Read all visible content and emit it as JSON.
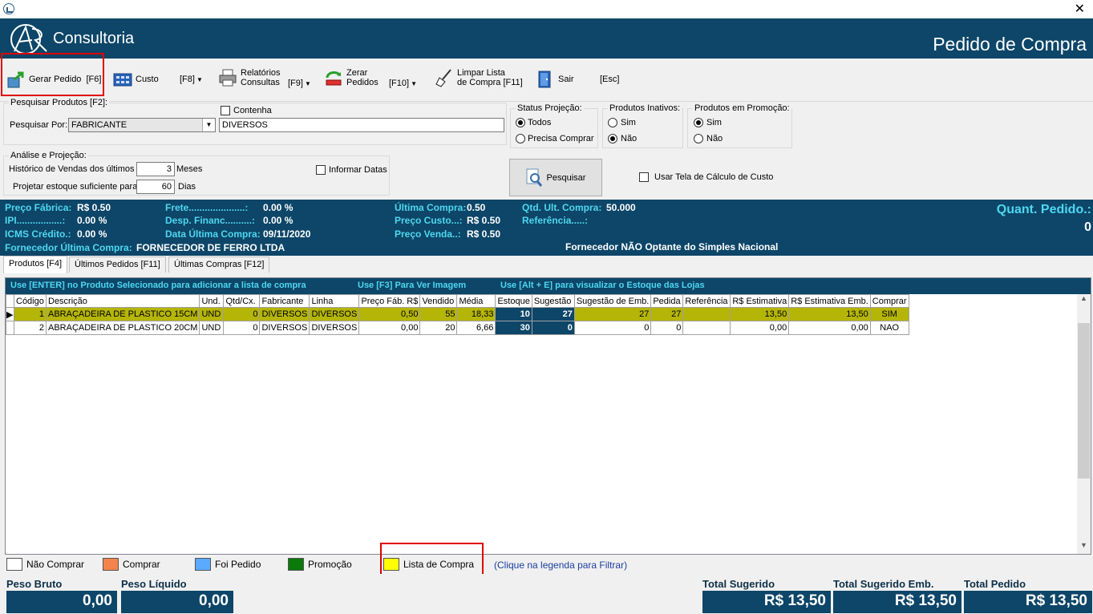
{
  "window": {
    "close_glyph": "✕"
  },
  "header": {
    "logo_text": "Consultoria",
    "page_title": "Pedido de Compra"
  },
  "toolbar": {
    "gerar_pedido": "Gerar Pedido",
    "gerar_pedido_key": "[F6]",
    "custo": "Custo",
    "custo_key": "[F8]",
    "relatorios_line1": "Relatórios",
    "relatorios_line2": "Consultas",
    "relatorios_key": "[F9]",
    "zerar_line1": "Zerar",
    "zerar_line2": "Pedidos",
    "zerar_key": "[F10]",
    "limpar_line1": "Limpar Lista",
    "limpar_line2": "de Compra [F11]",
    "sair": "Sair",
    "sair_key": "[Esc]"
  },
  "search": {
    "group_title": "Pesquisar Produtos [F2]:",
    "por_label": "Pesquisar Por:",
    "por_value": "FABRICANTE",
    "contenha_label": "Contenha",
    "term_value": "DIVERSOS"
  },
  "status_projecao": {
    "title": "Status Projeção:",
    "opt1": "Todos",
    "opt2": "Precisa Comprar"
  },
  "produtos_inativos": {
    "title": "Produtos Inativos:",
    "opt1": "Sim",
    "opt2": "Não"
  },
  "produtos_promocao": {
    "title": "Produtos em Promoção:",
    "opt1": "Sim",
    "opt2": "Não"
  },
  "analise": {
    "title": "Análise e Projeção:",
    "historico_label": "Histórico de Vendas dos últimos",
    "historico_value": "3",
    "meses": "Meses",
    "projetar_label": "Projetar estoque suficiente para",
    "projetar_value": "60",
    "dias": "Dias",
    "informar_datas": "Informar Datas"
  },
  "pesquisar_button": "Pesquisar",
  "usar_tela": "Usar Tela de Cálculo de Custo",
  "info": {
    "preco_fabrica_label": "Preço Fábrica:",
    "preco_fabrica": "R$ 0.50",
    "ipi_label": "IPI.................:",
    "ipi": "0.00 %",
    "icms_label": "ICMS Crédito.:",
    "icms": "0.00 %",
    "fornecedor_label": "Fornecedor Última Compra:",
    "fornecedor": "FORNECEDOR DE FERRO LTDA",
    "frete_label": "Frete.....................:",
    "frete": "0.00 %",
    "desp_label": "Desp. Financ..........:",
    "desp": "0.00 %",
    "data_label": "Data Última Compra:",
    "data": "09/11/2020",
    "ultima_compra_label": "Última Compra:",
    "ultima_compra": "0.50",
    "preco_custo_label": "Preço Custo...:",
    "preco_custo": "R$ 0.50",
    "preco_venda_label": "Preço Venda..:",
    "preco_venda": "R$ 0.50",
    "qtd_ult_label": "Qtd. Ult. Compra:",
    "qtd_ult": "50.000",
    "referencia_label": "Referência.....:",
    "simples": "Fornecedor NÃO Optante do Simples Nacional",
    "quant_pedido_label": "Quant. Pedido.:",
    "quant_pedido": "0"
  },
  "tabs": [
    "Produtos  [F4]",
    "Últimos Pedidos [F11]",
    "Últimas Compras [F12]"
  ],
  "banner": {
    "enter": "Use [ENTER] no Produto Selecionado para adicionar a lista de compra",
    "f3": "Use [F3] Para Ver Imagem",
    "alt": "Use [Alt + E] para visualizar o Estoque das Lojas"
  },
  "grid": {
    "columns": [
      "Código",
      "Descrição",
      "Und.",
      "Qtd/Cx.",
      "Fabricante",
      "Linha",
      "Preço Fáb. R$",
      "Vendido",
      "Média",
      "Estoque",
      "Sugestão",
      "Sugestão de Emb.",
      "Pedida",
      "Referência",
      "R$ Estimativa",
      "R$ Estimativa Emb.",
      "Comprar"
    ],
    "rows": [
      [
        "1",
        "ABRAÇADEIRA DE PLASTICO 15CM",
        "UND",
        "0",
        "DIVERSOS",
        "DIVERSOS",
        "0,50",
        "55",
        "18,33",
        "10",
        "27",
        "27",
        "27",
        "",
        "13,50",
        "13,50",
        "SIM"
      ],
      [
        "2",
        "ABRAÇADEIRA DE PLASTICO 20CM",
        "UND",
        "0",
        "DIVERSOS",
        "DIVERSOS",
        "0,00",
        "20",
        "6,66",
        "30",
        "0",
        "0",
        "0",
        "",
        "0,00",
        "0,00",
        "NAO"
      ]
    ]
  },
  "legend": {
    "nao_comprar": "Não Comprar",
    "comprar": "Comprar",
    "foi_pedido": "Foi Pedido",
    "promocao": "Promoção",
    "lista_compra": "Lista de Compra",
    "hint": "(Clique na legenda para Filtrar)",
    "colors": {
      "nao_comprar": "#ffffff",
      "comprar": "#f4844c",
      "foi_pedido": "#5aaaff",
      "promocao": "#0a7a0a",
      "lista_compra": "#ffff00"
    }
  },
  "totals": {
    "peso_bruto_label": "Peso Bruto",
    "peso_bruto": "0,00",
    "peso_liquido_label": "Peso Líquido",
    "peso_liquido": "0,00",
    "total_sugerido_label": "Total Sugerido",
    "total_sugerido": "R$ 13,50",
    "total_sugerido_emb_label": "Total Sugerido Emb.",
    "total_sugerido_emb": "R$ 13,50",
    "total_pedido_label": "Total Pedido",
    "total_pedido": "R$ 13,50"
  },
  "colors": {
    "brand_dark": "#0d4668",
    "accent_cyan": "#4fd7f0",
    "row_selected": "#b5b508",
    "highlight_red": "#e00000"
  }
}
